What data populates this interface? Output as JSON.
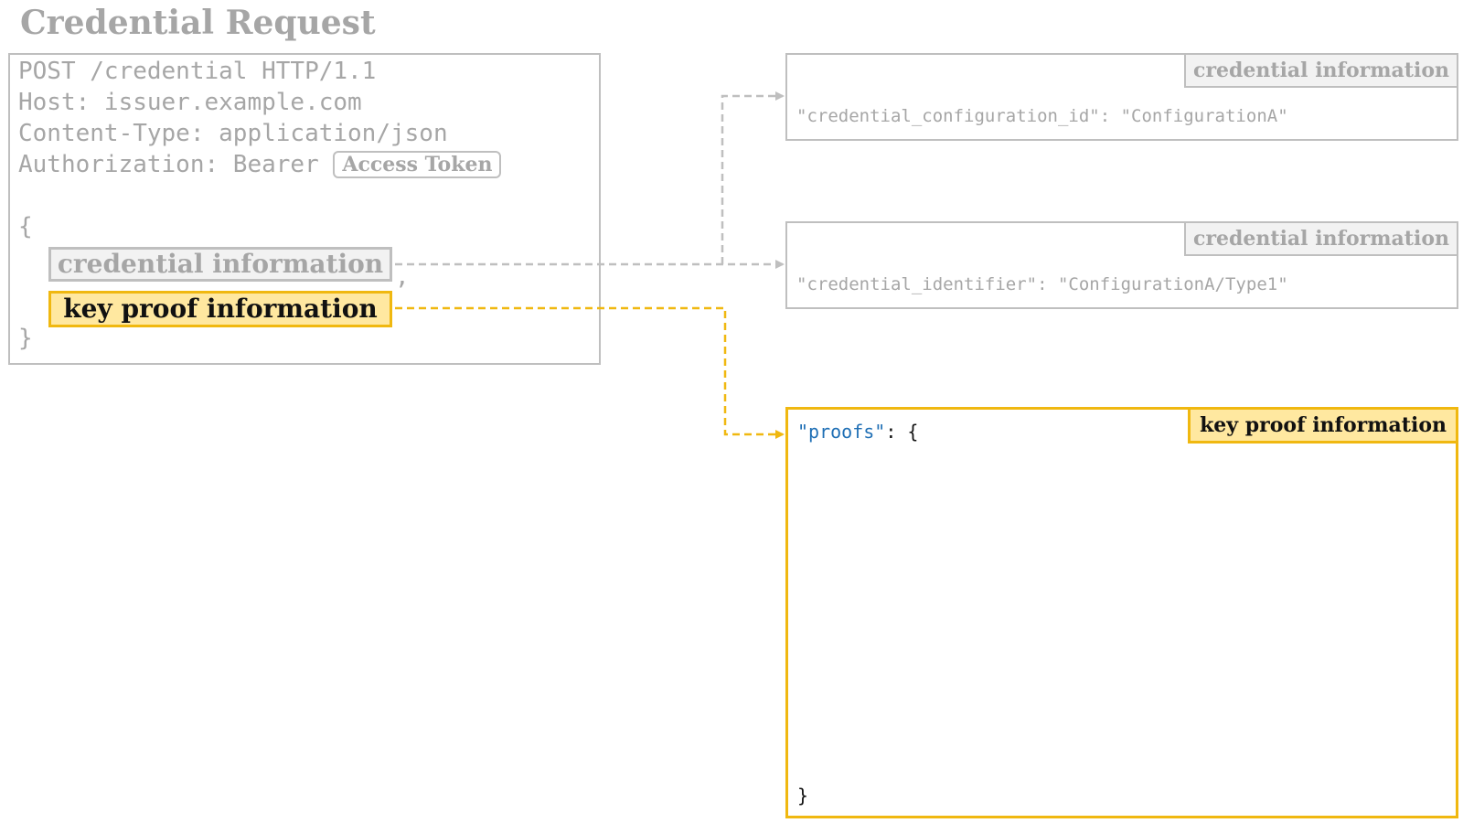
{
  "title": "Credential Request",
  "request": {
    "line1": "POST /credential HTTP/1.1",
    "line2": "Host: issuer.example.com",
    "line3": "Content-Type: application/json",
    "line4_prefix": "Authorization: Bearer",
    "access_token_label": "Access Token",
    "open_brace": "{",
    "credential_information_label": "credential information",
    "comma": ",",
    "key_proof_information_label": "key proof information",
    "close_brace": "}"
  },
  "outputs": [
    {
      "tag": "credential information",
      "code": "\"credential_configuration_id\": \"ConfigurationA\""
    },
    {
      "tag": "credential information",
      "code": "\"credential_identifier\": \"ConfigurationA/Type1\""
    }
  ],
  "key_proof": {
    "tag": "key proof information",
    "key": "\"proofs\"",
    "after_key": ": {",
    "close": "}"
  },
  "colors": {
    "gray_text": "#a6a6a6",
    "gray_border": "#bfbfbf",
    "yellow_border": "#f0b810",
    "yellow_fill": "#ffe8a0",
    "json_key_blue": "#1f6fb5"
  }
}
